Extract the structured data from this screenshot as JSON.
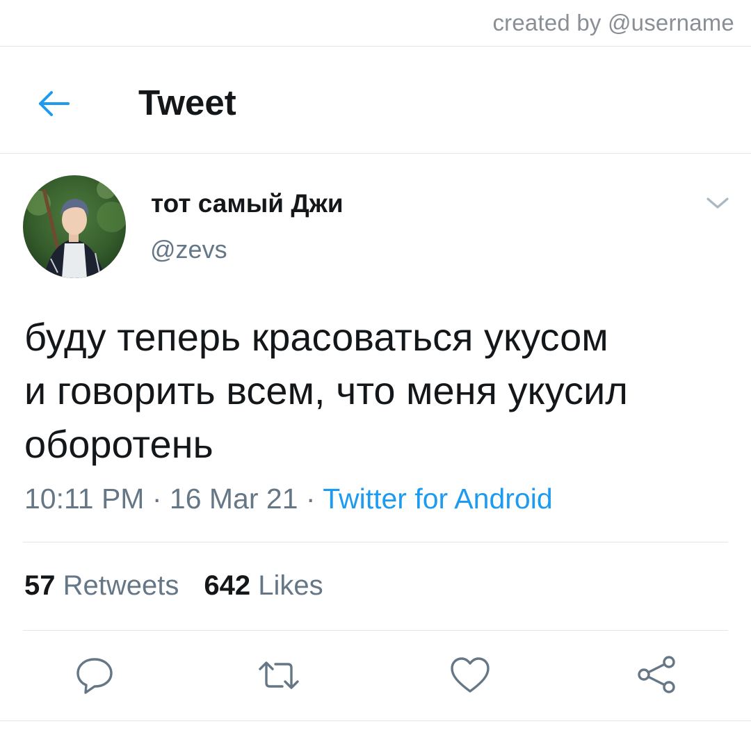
{
  "watermark": "created by @username",
  "header": {
    "title": "Tweet",
    "back_icon": "arrow-left-icon"
  },
  "tweet": {
    "author": {
      "display_name": "тот самый Джи",
      "handle": "@zevs"
    },
    "text_lines": [
      "буду теперь красоваться укусом",
      "и говорить всем, что меня укусил",
      "оборотень"
    ],
    "time": "10:11 PM",
    "date": "16 Mar 21",
    "separator": " · ",
    "source": "Twitter for Android",
    "retweets": {
      "count": "57",
      "label": "Retweets"
    },
    "likes": {
      "count": "642",
      "label": "Likes"
    }
  },
  "actions": [
    {
      "icon": "reply-icon"
    },
    {
      "icon": "retweet-icon"
    },
    {
      "icon": "like-icon"
    },
    {
      "icon": "share-icon"
    }
  ],
  "colors": {
    "accent": "#1d9bf0",
    "text": "#14171a",
    "secondary": "#657786",
    "divider": "#e3e6e8"
  }
}
